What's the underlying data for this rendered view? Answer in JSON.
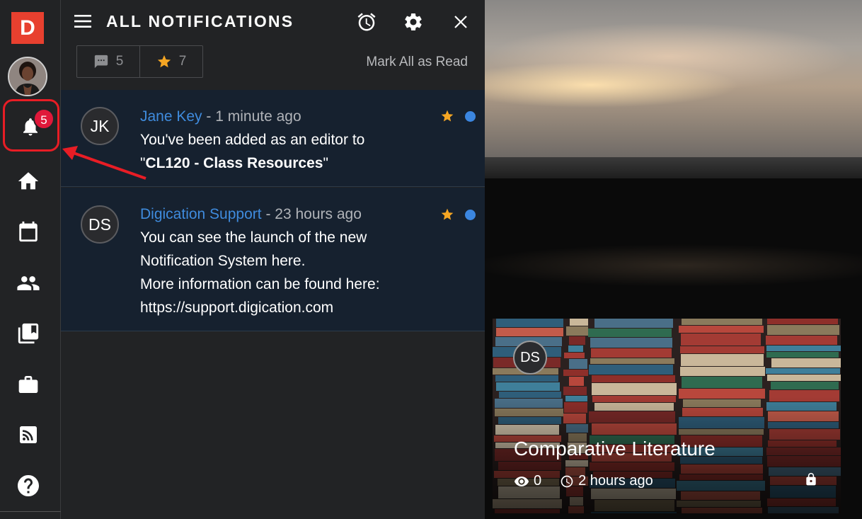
{
  "rail": {
    "logo_letter": "D",
    "notification_count": "5",
    "items": [
      {
        "icon": "bell-icon"
      },
      {
        "icon": "home-icon"
      },
      {
        "icon": "calendar-icon"
      },
      {
        "icon": "people-icon"
      },
      {
        "icon": "book-icon"
      },
      {
        "icon": "briefcase-icon"
      },
      {
        "icon": "rss-icon"
      },
      {
        "icon": "help-icon"
      }
    ]
  },
  "panel": {
    "title": "ALL NOTIFICATIONS",
    "header_icons": [
      "alarm-icon",
      "gear-icon",
      "close-icon"
    ],
    "filters": {
      "comments_count": "5",
      "starred_count": "7"
    },
    "mark_all_label": "Mark All as Read",
    "notifications": [
      {
        "initials": "JK",
        "author": "Jane Key",
        "separator": " - ",
        "time": "1 minute ago",
        "line1": "You've been added as an editor to",
        "quote_open": "\"",
        "bold": "CL120 - Class Resources",
        "quote_close": "\"",
        "starred": true,
        "unread": true
      },
      {
        "initials": "DS",
        "author": "Digication Support",
        "separator": " - ",
        "time": "23 hours ago",
        "lines": [
          "You can see the launch of the new",
          "Notification System here.",
          "More information can be found here:",
          "https://support.digication.com"
        ],
        "starred": true,
        "unread": true
      }
    ]
  },
  "card": {
    "initials": "DS",
    "title": "Comparative Literature",
    "views": "0",
    "time": "2 hours ago",
    "locked": true
  },
  "colors": {
    "brand": "#e8402f",
    "link": "#3f8bdd",
    "star": "#f5a623",
    "unread_dot": "#3b86e0",
    "badge": "#e0183a",
    "highlight": "#e81d25"
  }
}
